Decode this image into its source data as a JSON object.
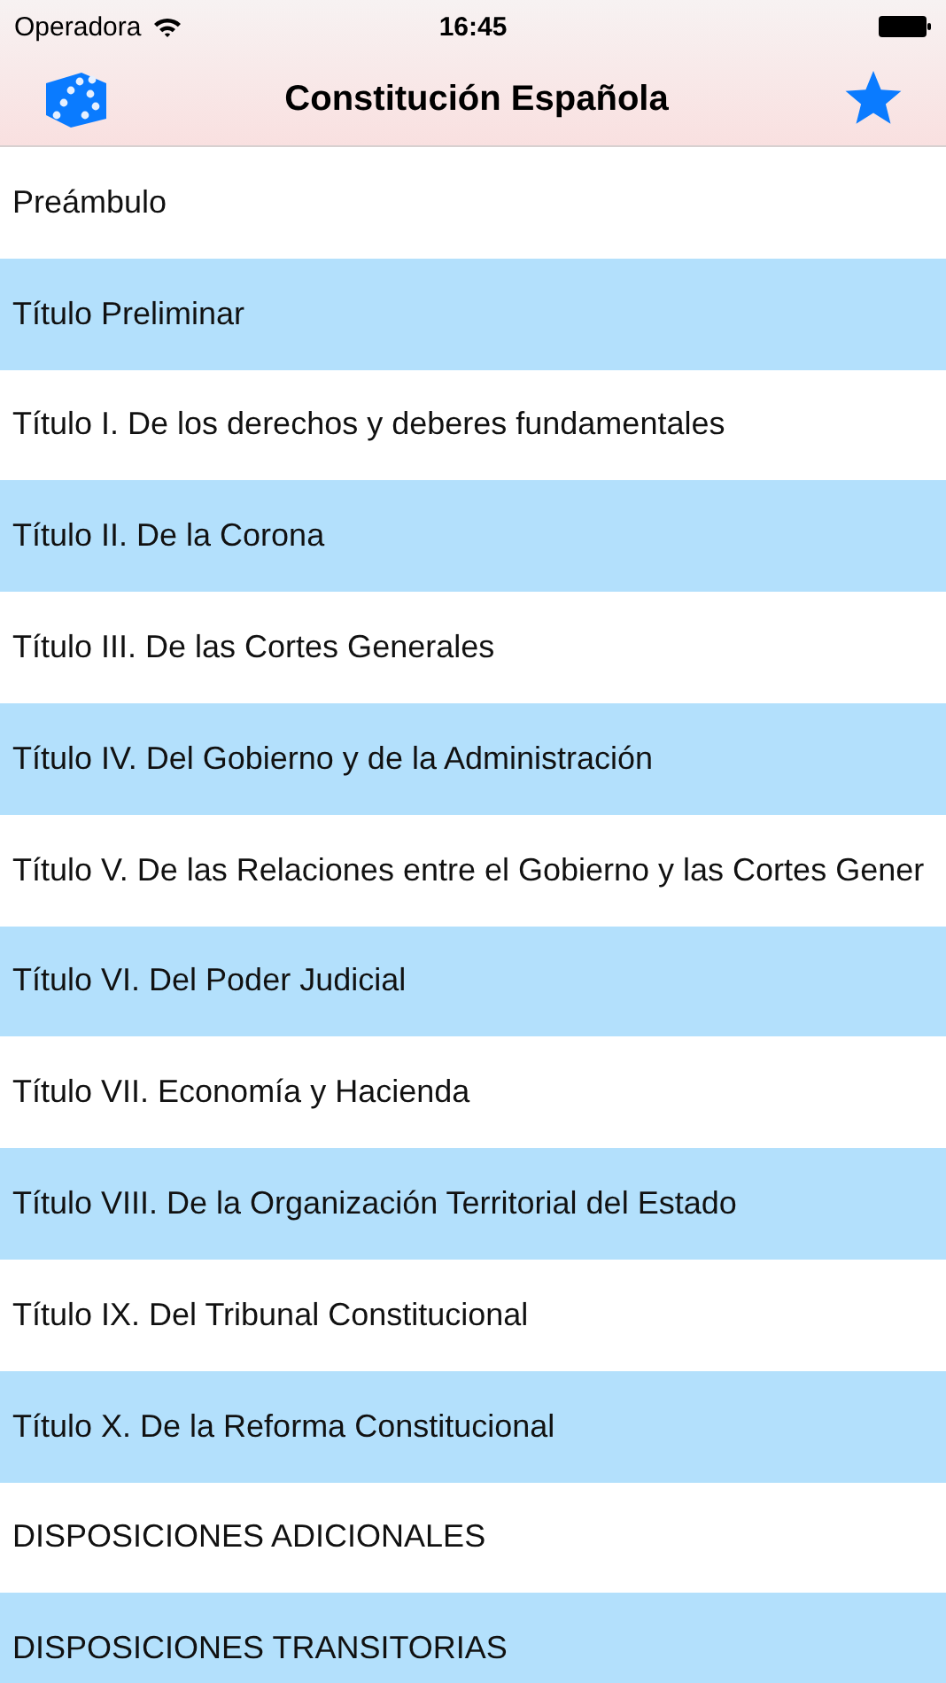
{
  "status_bar": {
    "carrier": "Operadora",
    "time": "16:45"
  },
  "nav_bar": {
    "title": "Constitución Española"
  },
  "items": [
    {
      "label": "Preámbulo"
    },
    {
      "label": "Título Preliminar"
    },
    {
      "label": "Título I. De los derechos y deberes fundamentales"
    },
    {
      "label": "Título II. De la Corona"
    },
    {
      "label": "Título III. De las Cortes Generales"
    },
    {
      "label": "Título IV. Del Gobierno y de la Administración"
    },
    {
      "label": "Título V. De las Relaciones entre el Gobierno y las Cortes Gener"
    },
    {
      "label": "Título VI. Del Poder Judicial"
    },
    {
      "label": "Título VII. Economía y Hacienda"
    },
    {
      "label": "Título VIII. De la Organización Territorial del Estado"
    },
    {
      "label": "Título IX. Del Tribunal Constitucional"
    },
    {
      "label": "Título X. De la Reforma Constitucional"
    },
    {
      "label": "DISPOSICIONES ADICIONALES"
    },
    {
      "label": "DISPOSICIONES TRANSITORIAS"
    }
  ]
}
